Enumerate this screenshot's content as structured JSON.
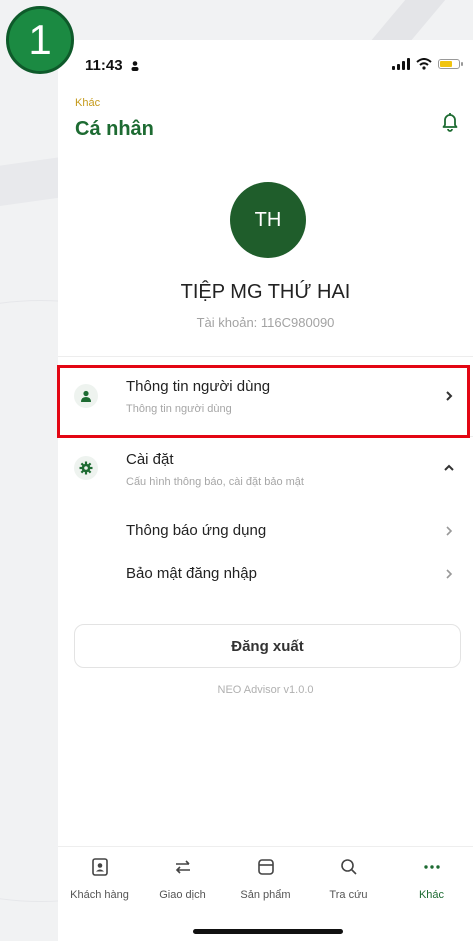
{
  "step_number": "1",
  "status_bar": {
    "time": "11:43"
  },
  "header": {
    "breadcrumb": "Khác",
    "title": "Cá nhân"
  },
  "profile": {
    "initials": "TH",
    "name": "TIỆP MG THỨ HAI",
    "account": "Tài khoản: 116C980090"
  },
  "menu": {
    "user_info": {
      "title": "Thông tin người dùng",
      "subtitle": "Thông tin người dùng"
    },
    "settings": {
      "title": "Cài đặt",
      "subtitle": "Cấu hình thông báo, cài đặt bảo mật",
      "items": [
        {
          "label": "Thông báo ứng dụng"
        },
        {
          "label": "Bảo mật đăng nhập"
        }
      ]
    }
  },
  "logout_label": "Đăng xuất",
  "version": "NEO Advisor v1.0.0",
  "tabs": [
    {
      "label": "Khách hàng",
      "icon": "contact-card-icon",
      "active": false
    },
    {
      "label": "Giao dịch",
      "icon": "swap-arrows-icon",
      "active": false
    },
    {
      "label": "Sản phẩm",
      "icon": "box-icon",
      "active": false
    },
    {
      "label": "Tra cứu",
      "icon": "search-icon",
      "active": false
    },
    {
      "label": "Khác",
      "icon": "more-dots-icon",
      "active": true
    }
  ],
  "colors": {
    "brand_green": "#1d6b32",
    "avatar_bg": "#1f5d2b",
    "breadcrumb_gold": "#c59a1a",
    "highlight_red": "#e30613",
    "step_badge": "#1b8a42"
  }
}
